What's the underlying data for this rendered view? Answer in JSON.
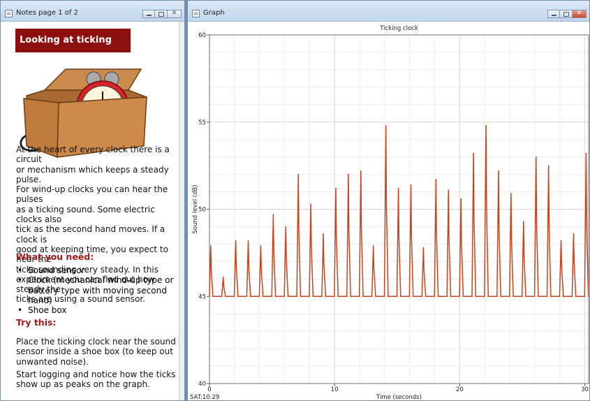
{
  "notes_window": {
    "title": "Notes page 1 of 2",
    "heading": "Looking at ticking clocks",
    "intro_lines": [
      "At the heart of every clock there is a circuit",
      "or mechanism which keeps a steady pulse.",
      "For wind-up clocks you can hear the pulses",
      "as a ticking sound.  Some electric clocks also",
      "tick as the second hand moves.  If a clock is",
      "good at keeping time, you expect to hear the",
      "ticks sounding very steady.  In this",
      "experiment you can find out how steady the",
      "ticks are using a sound sensor."
    ],
    "need_heading": "What you need:",
    "need_items": [
      "Sound sensor",
      "Clock (mechanical wind-up type or battery type with moving second hand)",
      "Shoe box"
    ],
    "try_heading": "Try this:",
    "try_p1": "Place the ticking clock near the sound sensor inside a shoe box (to keep out unwanted noise).",
    "try_p2": "Start logging and notice how the ticks show up as peaks on the graph."
  },
  "graph_window": {
    "title": "Graph",
    "status": "SAT:10:29"
  },
  "chart_data": {
    "type": "line",
    "title": "Ticking clock",
    "xlabel": "Time (seconds)",
    "ylabel": "Sound level (dB)",
    "xlim": [
      0,
      30.3
    ],
    "ylim": [
      40,
      60
    ],
    "x_ticks": [
      0,
      10,
      20,
      30
    ],
    "y_ticks": [
      40,
      45,
      50,
      55,
      60
    ],
    "grid": true,
    "baseline": 45,
    "series": [
      {
        "color": "#c8431c",
        "peaks": [
          {
            "t": 0.1,
            "v": 47.9
          },
          {
            "t": 1.1,
            "v": 46.1
          },
          {
            "t": 2.1,
            "v": 48.2
          },
          {
            "t": 3.1,
            "v": 48.2
          },
          {
            "t": 4.1,
            "v": 47.9
          },
          {
            "t": 5.1,
            "v": 49.7
          },
          {
            "t": 6.1,
            "v": 49.0
          },
          {
            "t": 7.1,
            "v": 52.0
          },
          {
            "t": 8.1,
            "v": 50.3
          },
          {
            "t": 9.1,
            "v": 48.6
          },
          {
            "t": 10.1,
            "v": 51.2
          },
          {
            "t": 11.1,
            "v": 52.0
          },
          {
            "t": 12.1,
            "v": 52.2
          },
          {
            "t": 13.1,
            "v": 47.9
          },
          {
            "t": 14.1,
            "v": 54.8
          },
          {
            "t": 15.1,
            "v": 51.2
          },
          {
            "t": 16.1,
            "v": 51.4
          },
          {
            "t": 17.1,
            "v": 47.8
          },
          {
            "t": 18.1,
            "v": 51.7
          },
          {
            "t": 19.1,
            "v": 51.1
          },
          {
            "t": 20.1,
            "v": 50.6
          },
          {
            "t": 21.1,
            "v": 53.2
          },
          {
            "t": 22.1,
            "v": 54.8
          },
          {
            "t": 23.1,
            "v": 52.2
          },
          {
            "t": 24.1,
            "v": 50.9
          },
          {
            "t": 25.1,
            "v": 49.3
          },
          {
            "t": 26.1,
            "v": 53.0
          },
          {
            "t": 27.1,
            "v": 52.5
          },
          {
            "t": 28.1,
            "v": 48.2
          },
          {
            "t": 29.1,
            "v": 48.6
          },
          {
            "t": 30.1,
            "v": 53.2
          }
        ]
      }
    ]
  }
}
